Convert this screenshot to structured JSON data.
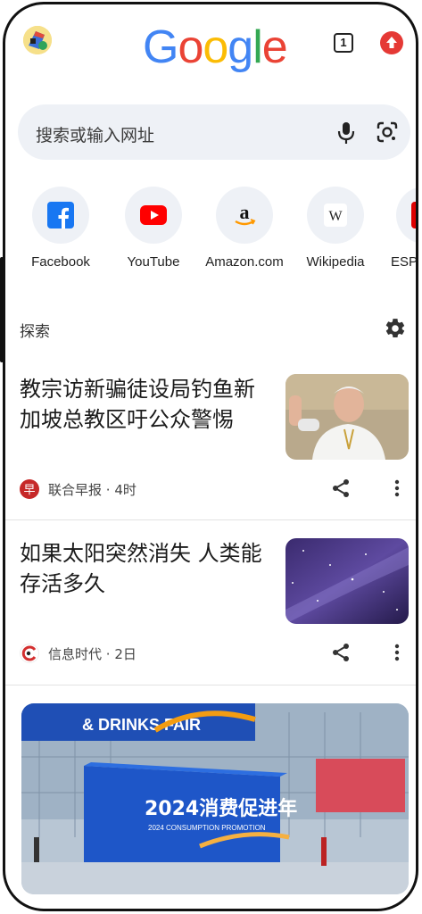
{
  "header": {
    "logo_text": "Google",
    "tab_count": "1",
    "logo_colors": [
      "#4285F4",
      "#EA4335",
      "#FBBC05",
      "#4285F4",
      "#34A853",
      "#EA4335"
    ]
  },
  "search": {
    "placeholder": "搜索或输入网址"
  },
  "shortcuts": [
    {
      "label": "Facebook",
      "icon": "facebook-icon"
    },
    {
      "label": "YouTube",
      "icon": "youtube-icon"
    },
    {
      "label": "Amazon.com",
      "icon": "amazon-icon"
    },
    {
      "label": "Wikipedia",
      "icon": "wikipedia-icon"
    },
    {
      "label": "ESPN",
      "icon": "espn-icon"
    }
  ],
  "discover": {
    "title": "探索"
  },
  "articles": [
    {
      "title": "教宗访新骗徒设局钓鱼新加坡总教区吁公众警惕",
      "source": "联合早报",
      "time": "4时"
    },
    {
      "title": "如果太阳突然消失 人类能存活多久",
      "source": "信息时代",
      "time": "2日"
    }
  ],
  "feature_image": {
    "banner_line1": "& DRINKS FAIR",
    "sign_main": "2024消费促进年",
    "sign_sub": "2024 CONSUMPTION PROMOTION"
  },
  "colors": {
    "accent_red": "#e53935",
    "facebook_blue": "#1877F2",
    "youtube_red": "#FF0000",
    "search_bg": "#eef1f6"
  }
}
